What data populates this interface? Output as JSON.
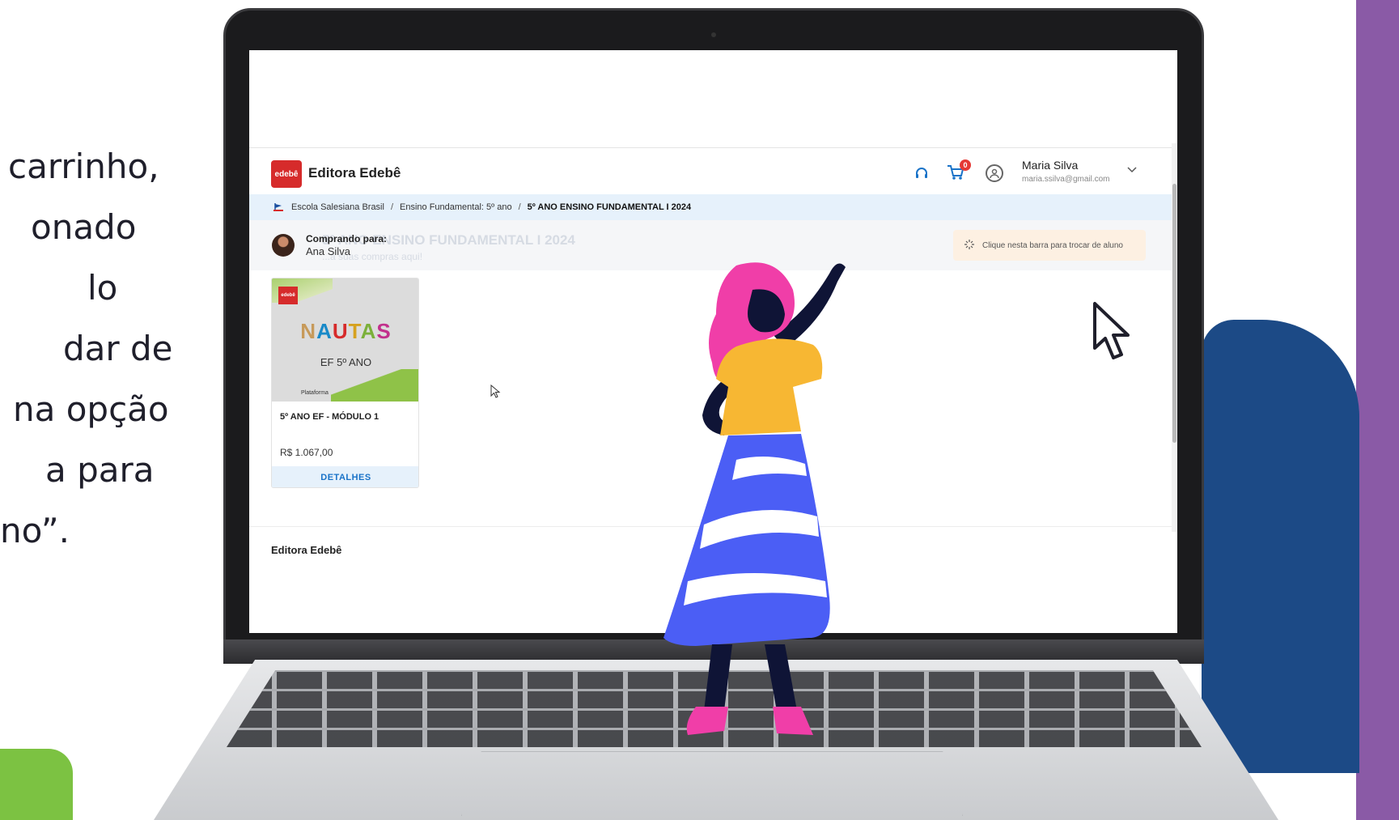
{
  "left_text": {
    "lines": [
      "carrinho,",
      "onado",
      "lo",
      "dar de",
      "na opção",
      "a para",
      "no”."
    ]
  },
  "app": {
    "title": "Editora Edebê",
    "logo_text": "edebê",
    "cart_count": "0",
    "user": {
      "name": "Maria Silva",
      "email": "maria.ssilva@gmail.com"
    },
    "icons": {
      "support": "headset-icon",
      "cart": "cart-icon",
      "user": "user-circle-icon",
      "chevron": "chevron-down-icon"
    }
  },
  "breadcrumb": {
    "items": [
      "Escola Salesiana Brasil",
      "Ensino Fundamental: 5º ano",
      "5º ANO ENSINO FUNDAMENTAL I 2024"
    ],
    "separator": "/"
  },
  "buying_bar": {
    "ghost_title": "5º ANO ENSINO FUNDAMENTAL I 2024",
    "ghost_subtitle": "...a suas compras aqui!",
    "label": "Comprando para:",
    "student": "Ana Silva",
    "switch_button": "Clique nesta barra para trocar de aluno"
  },
  "product": {
    "cover_logo": "edebê",
    "series_letters": [
      "N",
      "A",
      "U",
      "T",
      "A",
      "S"
    ],
    "grade": "EF 5º ANO",
    "platform": "Plataforma",
    "title": "5º ANO EF - MÓDULO 1",
    "price": "R$ 1.067,00",
    "details_button": "DETALHES"
  },
  "footer": {
    "brand": "Editora Edebê"
  },
  "colors": {
    "brand_red": "#d62b2b",
    "accent_blue": "#1a73c8",
    "breadcrumb_bg": "#e6f1fb",
    "switch_bg": "#fdf0e2",
    "bg_purple": "#8a5aa6",
    "bg_blue": "#1c4a86",
    "bg_green": "#7cc242"
  }
}
